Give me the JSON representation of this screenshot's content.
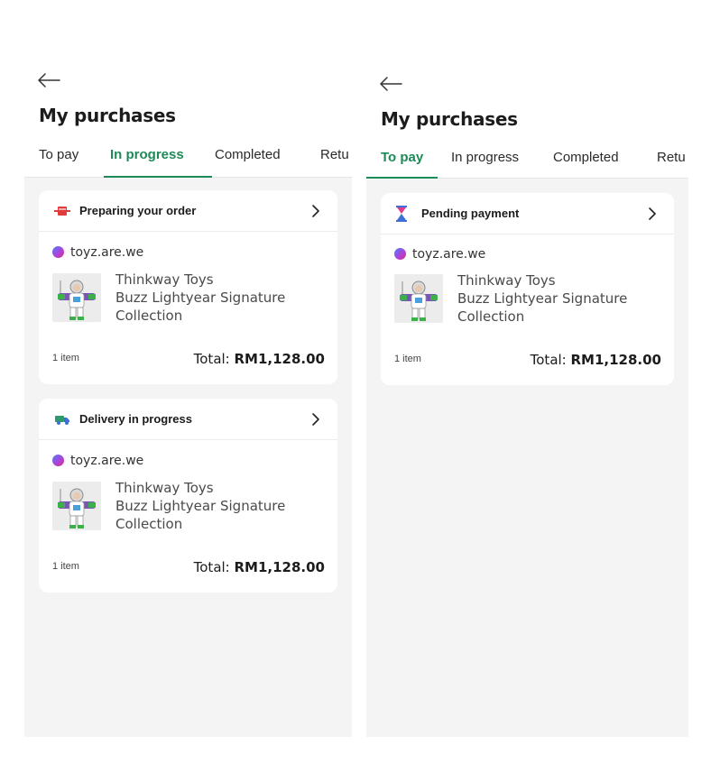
{
  "screens": [
    {
      "title": "My purchases",
      "tabs": [
        {
          "label": "To pay"
        },
        {
          "label": "In progress"
        },
        {
          "label": "Completed"
        },
        {
          "label": "Retu"
        }
      ],
      "active_tab": "In progress",
      "orders": [
        {
          "status": "Preparing your order",
          "status_icon": "package-icon",
          "store": "toyz.are.we",
          "product": {
            "brand": "Thinkway Toys",
            "name_line1": "Buzz Lightyear Signature",
            "name_line2": "Collection"
          },
          "item_count": "1 item",
          "total_label": "Total:",
          "total_value": "RM1,128.00"
        },
        {
          "status": "Delivery in progress",
          "status_icon": "delivery-truck-icon",
          "store": "toyz.are.we",
          "product": {
            "brand": "Thinkway Toys",
            "name_line1": "Buzz Lightyear Signature",
            "name_line2": "Collection"
          },
          "item_count": "1 item",
          "total_label": "Total:",
          "total_value": "RM1,128.00"
        }
      ]
    },
    {
      "title": "My purchases",
      "tabs": [
        {
          "label": "To pay"
        },
        {
          "label": "In progress"
        },
        {
          "label": "Completed"
        },
        {
          "label": "Retu"
        }
      ],
      "active_tab": "To pay",
      "orders": [
        {
          "status": "Pending payment",
          "status_icon": "hourglass-icon",
          "store": "toyz.are.we",
          "product": {
            "brand": "Thinkway Toys",
            "name_line1": "Buzz Lightyear Signature",
            "name_line2": "Collection"
          },
          "item_count": "1 item",
          "total_label": "Total:",
          "total_value": "RM1,128.00"
        }
      ]
    }
  ],
  "colors": {
    "accent": "#1e8a57",
    "background": "#f4f4f4",
    "card": "#ffffff"
  }
}
